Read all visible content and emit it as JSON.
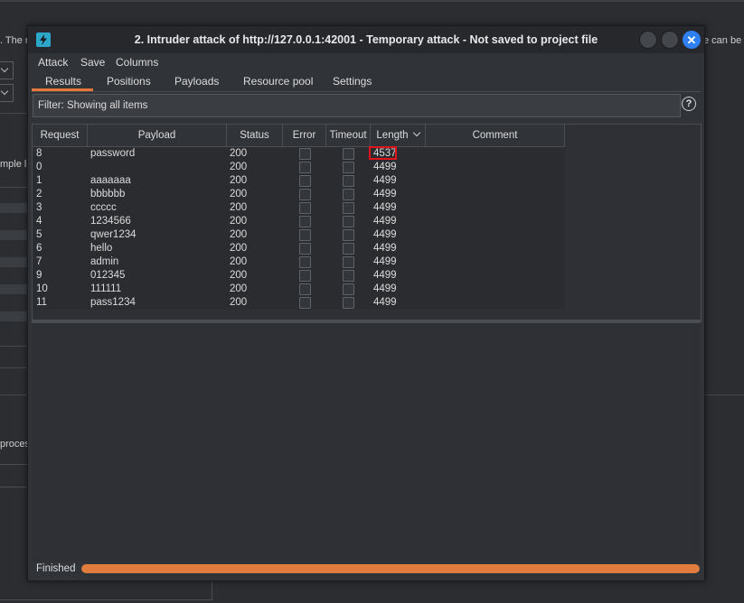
{
  "background": {
    "fragments": [
      ". The n",
      "e can be c",
      "mple li",
      "proces"
    ]
  },
  "window": {
    "title": "2. Intruder attack of http://127.0.0.1:42001 - Temporary attack - Not saved to project file",
    "icon": "burp-lightning-icon"
  },
  "menu": [
    "Attack",
    "Save",
    "Columns"
  ],
  "tabs": [
    "Results",
    "Positions",
    "Payloads",
    "Resource pool",
    "Settings"
  ],
  "active_tab": "Results",
  "filter": {
    "text": "Filter: Showing all items"
  },
  "table": {
    "columns": [
      "Request",
      "Payload",
      "Status",
      "Error",
      "Timeout",
      "Length",
      "Comment"
    ],
    "sorted_by": "Length",
    "rows": [
      {
        "request": "8",
        "payload": "password",
        "status": "200",
        "length": "4537"
      },
      {
        "request": "0",
        "payload": "",
        "status": "200",
        "length": "4499"
      },
      {
        "request": "1",
        "payload": "aaaaaaa",
        "status": "200",
        "length": "4499"
      },
      {
        "request": "2",
        "payload": "bbbbbb",
        "status": "200",
        "length": "4499"
      },
      {
        "request": "3",
        "payload": "ccccc",
        "status": "200",
        "length": "4499"
      },
      {
        "request": "4",
        "payload": "1234566",
        "status": "200",
        "length": "4499"
      },
      {
        "request": "5",
        "payload": "qwer1234",
        "status": "200",
        "length": "4499"
      },
      {
        "request": "6",
        "payload": "hello",
        "status": "200",
        "length": "4499"
      },
      {
        "request": "7",
        "payload": "admin",
        "status": "200",
        "length": "4499"
      },
      {
        "request": "9",
        "payload": "012345",
        "status": "200",
        "length": "4499"
      },
      {
        "request": "10",
        "payload": "111111",
        "status": "200",
        "length": "4499"
      },
      {
        "request": "11",
        "payload": "pass1234",
        "status": "200",
        "length": "4499"
      }
    ],
    "highlighted_row_index": 0
  },
  "status": {
    "text": "Finished",
    "progress": 1.0
  },
  "colors": {
    "accent": "#e8773b",
    "highlight": "#e0141d",
    "close": "#2f7ff0"
  }
}
